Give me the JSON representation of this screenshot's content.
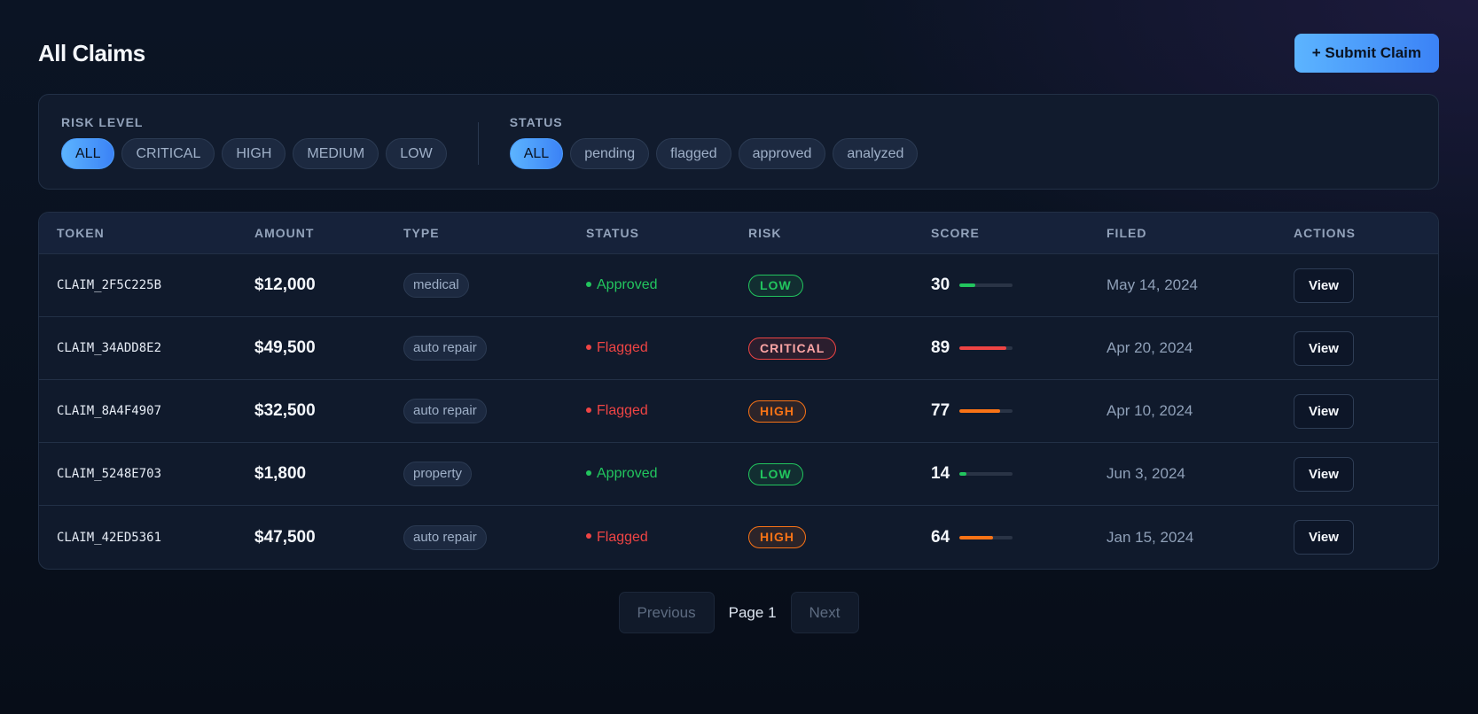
{
  "header": {
    "title": "All Claims",
    "submit_label": "+ Submit Claim"
  },
  "filters": {
    "risk": {
      "label": "RISK LEVEL",
      "options": [
        "ALL",
        "CRITICAL",
        "HIGH",
        "MEDIUM",
        "LOW"
      ],
      "selected": "ALL"
    },
    "status": {
      "label": "STATUS",
      "options": [
        "ALL",
        "pending",
        "flagged",
        "approved",
        "analyzed"
      ],
      "selected": "ALL"
    }
  },
  "table": {
    "columns": [
      "TOKEN",
      "AMOUNT",
      "TYPE",
      "STATUS",
      "RISK",
      "SCORE",
      "FILED",
      "ACTIONS"
    ],
    "rows": [
      {
        "token": "CLAIM_2F5C225B",
        "amount": "$12,000",
        "type": "medical",
        "status": "Approved",
        "risk": "LOW",
        "score": "30",
        "filed": "May 14, 2024",
        "action": "View"
      },
      {
        "token": "CLAIM_34ADD8E2",
        "amount": "$49,500",
        "type": "auto repair",
        "status": "Flagged",
        "risk": "CRITICAL",
        "score": "89",
        "filed": "Apr 20, 2024",
        "action": "View"
      },
      {
        "token": "CLAIM_8A4F4907",
        "amount": "$32,500",
        "type": "auto repair",
        "status": "Flagged",
        "risk": "HIGH",
        "score": "77",
        "filed": "Apr 10, 2024",
        "action": "View"
      },
      {
        "token": "CLAIM_5248E703",
        "amount": "$1,800",
        "type": "property",
        "status": "Approved",
        "risk": "LOW",
        "score": "14",
        "filed": "Jun 3, 2024",
        "action": "View"
      },
      {
        "token": "CLAIM_42ED5361",
        "amount": "$47,500",
        "type": "auto repair",
        "status": "Flagged",
        "risk": "HIGH",
        "score": "64",
        "filed": "Jan 15, 2024",
        "action": "View"
      }
    ]
  },
  "pagination": {
    "previous": "Previous",
    "page_label": "Page 1",
    "next": "Next"
  },
  "colors": {
    "accent": "#3b82f6",
    "approved": "#22c55e",
    "flagged": "#ef4444",
    "low": "#22c55e",
    "high": "#f97316",
    "critical": "#ef4444"
  }
}
